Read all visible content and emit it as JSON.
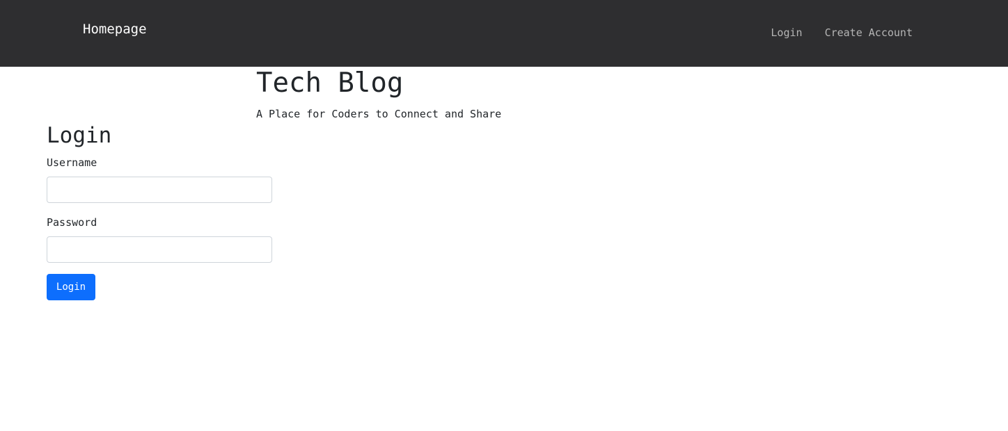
{
  "navbar": {
    "brand": "Homepage",
    "links": [
      "Login",
      "Create Account"
    ]
  },
  "hero": {
    "title": "Tech Blog",
    "subtitle": "A Place for Coders to Connect and Share"
  },
  "login_form": {
    "heading": "Login",
    "username_label": "Username",
    "username_value": "",
    "password_label": "Password",
    "password_value": "",
    "submit_label": "Login"
  },
  "colors": {
    "navbar_bg": "#2e2e30",
    "brand_text": "#ffffff",
    "nav_link_text": "#b5b5b5",
    "button_bg": "#0d6efd",
    "button_text": "#ffffff"
  }
}
